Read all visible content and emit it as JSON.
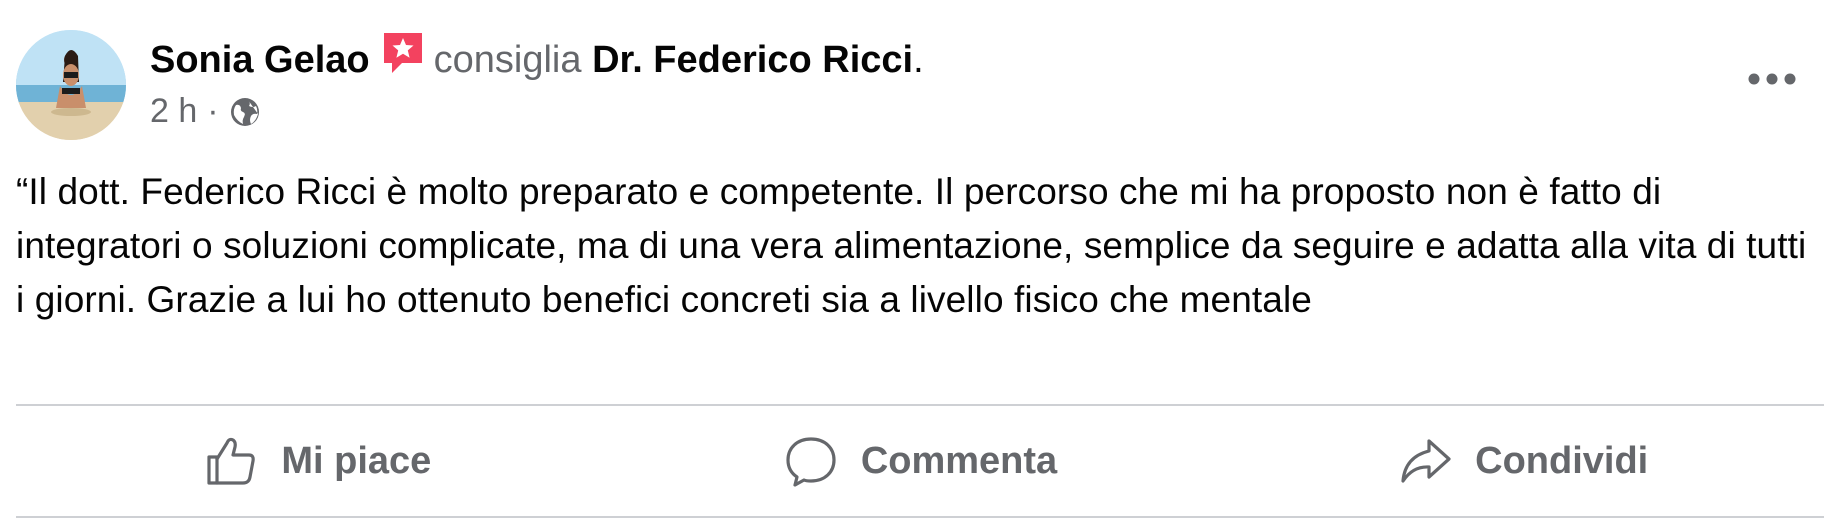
{
  "post": {
    "author": {
      "name": "Sonia Gelao",
      "avatar_icon": "profile-photo-beach"
    },
    "recommend_icon": "recommendation-star-icon",
    "recommend_color": "#f3425f",
    "recommends_text": "consiglia",
    "page_name": "Dr. Federico Ricci",
    "period": ".",
    "time": "2 h",
    "separator": "·",
    "audience_icon": "globe-icon",
    "more_icon": "more-horizontal-icon",
    "text": "“Il dott. Federico Ricci è molto preparato e competente. Il percorso che mi ha proposto non è fatto di integratori o soluzioni complicate, ma di una vera alimentazione, semplice da seguire e adatta alla vita di tutti i giorni. Grazie a lui ho ottenuto benefici concreti sia a livello fisico che mentale"
  },
  "actions": {
    "like": {
      "label": "Mi piace",
      "icon": "thumbs-up-icon"
    },
    "comment": {
      "label": "Commenta",
      "icon": "speech-bubble-icon"
    },
    "share": {
      "label": "Condividi",
      "icon": "share-arrow-icon"
    }
  },
  "colors": {
    "text_primary": "#050505",
    "text_secondary": "#65676b",
    "divider": "#ced0d4"
  }
}
